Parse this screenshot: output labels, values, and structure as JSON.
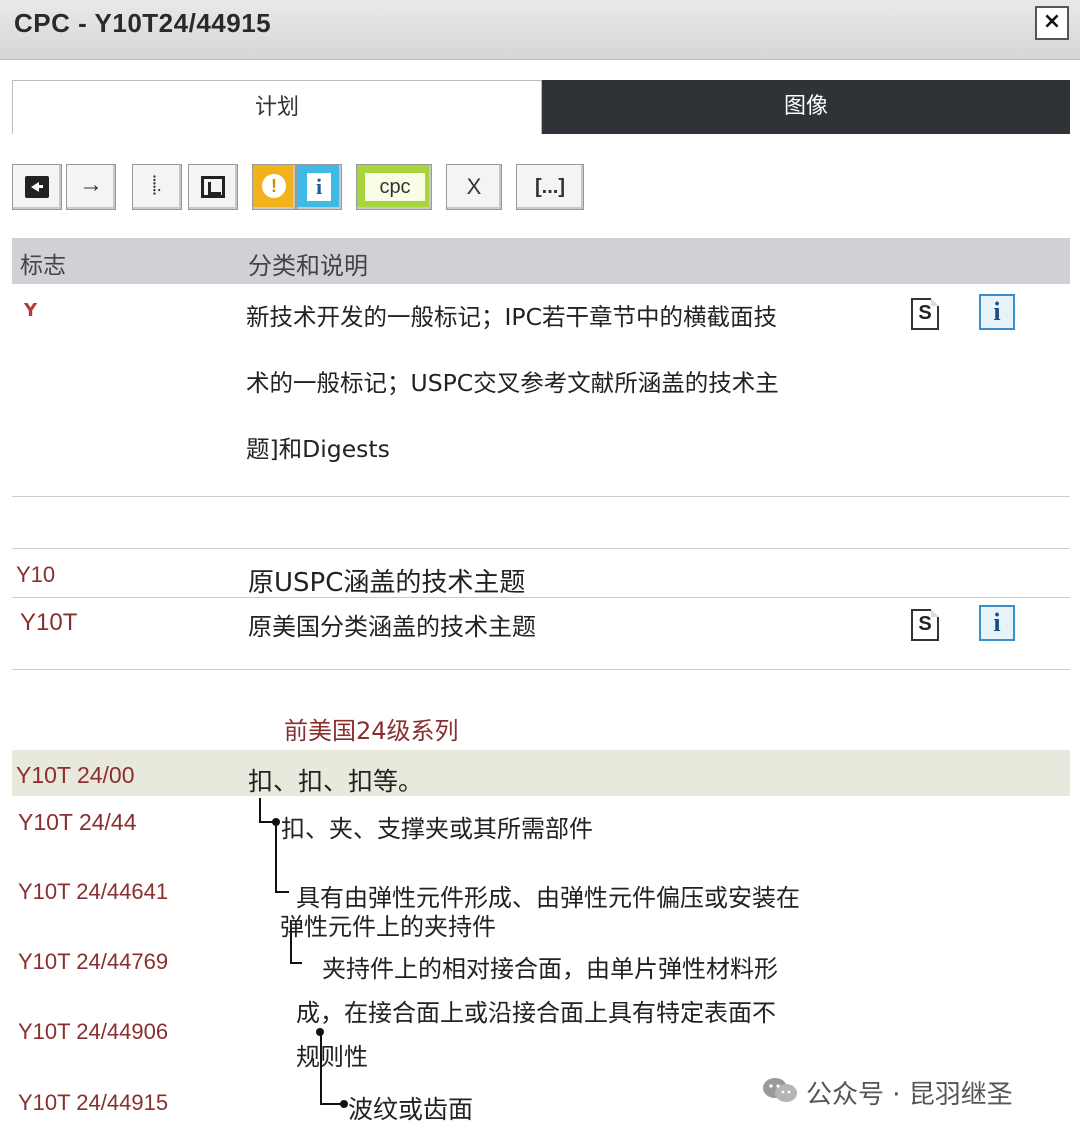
{
  "window": {
    "title": "CPC - Y10T24/44915",
    "close_label": "×"
  },
  "tabs": [
    {
      "label": "计划"
    },
    {
      "label": "图像"
    }
  ],
  "toolbar": {
    "next_glyph": "→",
    "tree_glyph": "⸽.",
    "warn_glyph": "!",
    "info_glyph": "i",
    "cpc_label": "cpc",
    "x_label": "X",
    "more_label": "[...]"
  },
  "table_header": {
    "flag": "标志",
    "classification": "分类和说明"
  },
  "rows": {
    "y_section": {
      "flag_glyph": "Y",
      "desc_lines": [
        "新技术开发的一般标记；IPC若干章节中的横截面技",
        "术的一般标记；USPC交叉参考文献所涵盖的技术主",
        "题]和Digests"
      ]
    },
    "y10": {
      "code": "Y10",
      "desc": "原USPC涵盖的技术主题"
    },
    "y10t": {
      "code": "Y10T",
      "desc": "原美国分类涵盖的技术主题"
    },
    "series_heading": "前美国24级系列",
    "y10t_24_00": {
      "code": "Y10T 24/00",
      "desc": "扣、扣、扣等。"
    },
    "y10t_24_44": {
      "code": "Y10T 24/44",
      "desc": "扣、夹、支撑夹或其所需部件"
    },
    "y10t_24_44641": {
      "code": "Y10T 24/44641",
      "desc_lines": [
        "具有由弹性元件形成、由弹性元件偏压或安装在",
        "弹性元件上的夹持件"
      ]
    },
    "y10t_24_44769": {
      "code": "Y10T 24/44769",
      "desc_lines": [
        "夹持件上的相对接合面，由单片弹性材料形",
        "成，在接合面上或沿接合面上具有特定表面不",
        "规则性"
      ]
    },
    "y10t_24_44906": {
      "code": "Y10T 24/44906"
    },
    "y10t_24_44915": {
      "code": "Y10T 24/44915",
      "desc": "波纹或齿面"
    }
  },
  "icons": {
    "s_glyph": "S",
    "i_glyph": "i"
  },
  "watermark": {
    "text": "公众号 · 昆羽继圣"
  }
}
